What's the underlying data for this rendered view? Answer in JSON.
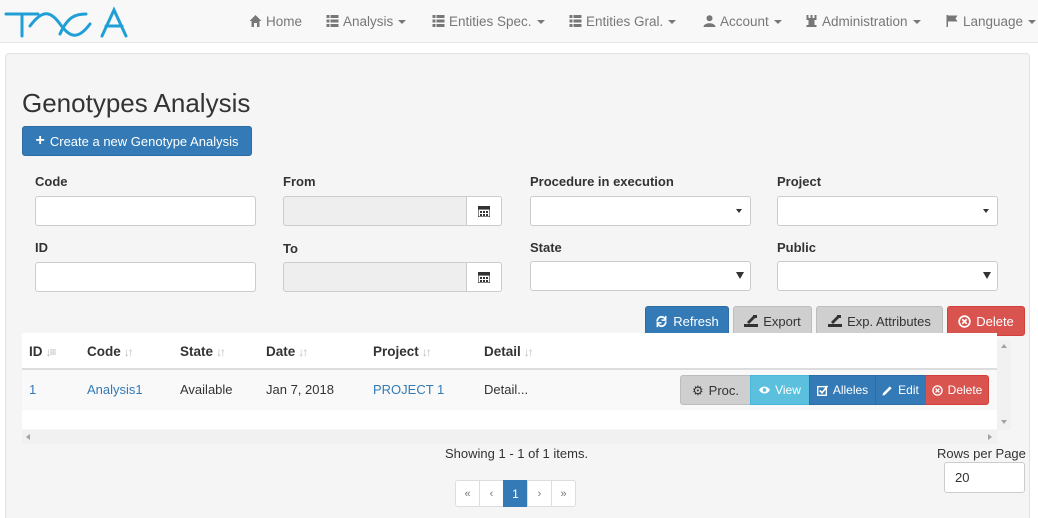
{
  "navbar": {
    "items": [
      {
        "label": "Home",
        "icon": "home-icon",
        "caret": false
      },
      {
        "label": "Analysis",
        "icon": "list-icon",
        "caret": true
      },
      {
        "label": "Entities Spec.",
        "icon": "list-icon",
        "caret": true
      },
      {
        "label": "Entities Gral.",
        "icon": "list-icon",
        "caret": true
      },
      {
        "label": "Account",
        "icon": "user-icon",
        "caret": true
      },
      {
        "label": "Administration",
        "icon": "tower-icon",
        "caret": true
      },
      {
        "label": "Language",
        "icon": "flag-icon",
        "caret": true
      }
    ]
  },
  "page": {
    "title": "Genotypes Analysis",
    "create_button": "Create a new Genotype Analysis"
  },
  "filters": {
    "code_label": "Code",
    "from_label": "From",
    "procedure_label": "Procedure in execution",
    "project_label": "Project",
    "id_label": "ID",
    "to_label": "To",
    "state_label": "State",
    "public_label": "Public",
    "code_value": "",
    "id_value": ""
  },
  "actions": {
    "refresh": "Refresh",
    "export": "Export",
    "export_attributes": "Exp. Attributes",
    "delete": "Delete"
  },
  "table": {
    "columns": [
      "ID",
      "Code",
      "State",
      "Date",
      "Project",
      "Detail"
    ],
    "rows": [
      {
        "id": "1",
        "code": "Analysis1",
        "state": "Available",
        "date": "Jan 7, 2018",
        "project": "PROJECT 1",
        "detail": "Detail...",
        "buttons": {
          "proc": "Proc.",
          "view": "View",
          "alleles": "Alleles",
          "edit": "Edit",
          "delete": "Delete"
        }
      }
    ]
  },
  "footer": {
    "showing": "Showing 1 - 1 of 1 items.",
    "rows_per_page_label": "Rows per Page",
    "rows_per_page_value": "20",
    "pager": {
      "first": "«",
      "prev": "‹",
      "current": "1",
      "next": "›",
      "last": "»"
    }
  },
  "colors": {
    "primary": "#337ab7",
    "danger": "#d9534f",
    "info": "#5bc0de",
    "logo": "#1f9fd6"
  }
}
